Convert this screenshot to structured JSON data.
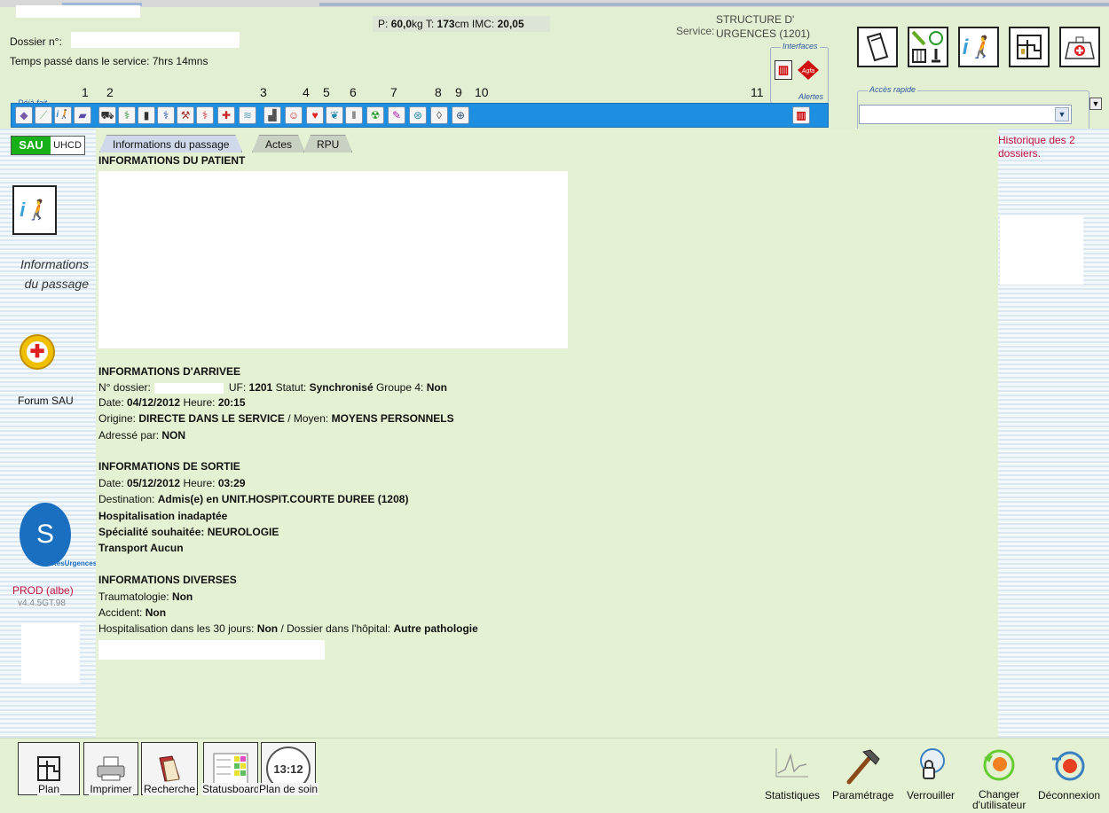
{
  "header": {
    "dossier_label": "Dossier n°:",
    "time_in_service_label": "Temps passé dans le service:",
    "time_in_service_value": "7hrs 14mns",
    "vitals": {
      "p_label": "P:",
      "p_value": "60,0",
      "p_unit": "kg",
      "t_label": "T:",
      "t_value": "173",
      "t_unit": "cm",
      "imc_label": "IMC:",
      "imc_value": "20,05"
    },
    "service_label": "Service:",
    "service_value_1": "STRUCTURE D'",
    "service_value_2": "URGENCES (1201)",
    "interfaces_label": "Interfaces",
    "alertes_label": "Alertes",
    "deja_fait_label": "Déjà fait",
    "acces_rapide_label": "Accès rapide",
    "toolbar_numbers": [
      "1",
      "2",
      "3",
      "4",
      "5",
      "6",
      "7",
      "8",
      "9",
      "10",
      "11"
    ],
    "toolbar_icons": [
      "eraser-icon",
      "chart-icon",
      "info-person-icon",
      "book-icon",
      "trolley-icon",
      "caduceus-icon",
      "pillar-icon",
      "caduceus-blue-icon",
      "hammer-icon",
      "caduceus-red-icon",
      "first-aid-icon",
      "xray-icon",
      "chair-icon",
      "head-icon",
      "heart-icon",
      "lungs-icon",
      "vials-icon",
      "radioactive-icon",
      "pen-icon",
      "body-icon",
      "bladder-icon",
      "compass-icon"
    ],
    "big_buttons": [
      "folder-icon",
      "lab-tools-icon",
      "info-person-icon",
      "floorplan-icon",
      "first-aid-kit-icon"
    ]
  },
  "left": {
    "sau": "SAU",
    "uhcd": "UHCD",
    "info_caption": "Informations du passage",
    "forum": "Forum SAU",
    "logo_text": "ResUrgences",
    "prod": "PROD (albe)",
    "version": "v4.4.5GT.98"
  },
  "tabs": [
    "Informations du passage",
    "Actes",
    "RPU"
  ],
  "right": {
    "history": "Historique des 2 dossiers."
  },
  "main": {
    "patient_title": "INFORMATIONS DU PATIENT",
    "arrivee_title": "INFORMATIONS D'ARRIVEE",
    "arrivee": {
      "dossier_label": "N° dossier:",
      "uf_label": "UF:",
      "uf_value": "1201",
      "statut_label": "Statut:",
      "statut_value": "Synchronisé",
      "groupe_label": "Groupe 4:",
      "groupe_value": "Non",
      "date_label": "Date:",
      "date_value": "04/12/2012",
      "heure_label": "Heure:",
      "heure_value": "20:15",
      "origine_label": "Origine:",
      "origine_value": "DIRECTE DANS LE SERVICE",
      "moyen_label": "/ Moyen:",
      "moyen_value": "MOYENS PERSONNELS",
      "adresse_label": "Adressé par:",
      "adresse_value": "NON"
    },
    "sortie_title": "INFORMATIONS DE SORTIE",
    "sortie": {
      "date_label": "Date:",
      "date_value": "05/12/2012",
      "heure_label": "Heure:",
      "heure_value": "03:29",
      "destination_label": "Destination:",
      "destination_value": "Admis(e) en UNIT.HOSPIT.COURTE DUREE (1208)",
      "line3": "Hospitalisation inadaptée",
      "specialite_label": "Spécialité souhaitée:",
      "specialite_value": "NEUROLOGIE",
      "transport": "Transport Aucun"
    },
    "diverses_title": "INFORMATIONS DIVERSES",
    "diverses": {
      "trauma_label": "Traumatologie:",
      "trauma_value": "Non",
      "accident_label": "Accident:",
      "accident_value": "Non",
      "hospit_label": "Hospitalisation dans les 30 jours:",
      "hospit_value": "Non",
      "dossier_hop_label": "/ Dossier dans l'hôpital:",
      "dossier_hop_value": "Autre pathologie"
    }
  },
  "footer": {
    "left_buttons": [
      "Plan",
      "Imprimer",
      "Recherche",
      "Statusboard",
      "Plan de soin"
    ],
    "clock_time": "13:12",
    "right_tools": [
      "Statistiques",
      "Paramétrage",
      "Verrouiller",
      "Changer d'utilisateur",
      "Déconnexion"
    ]
  },
  "colors": {
    "toolbar_blue": "#1e8fe0",
    "sau_green": "#18b018",
    "history_red": "#c0143c"
  }
}
